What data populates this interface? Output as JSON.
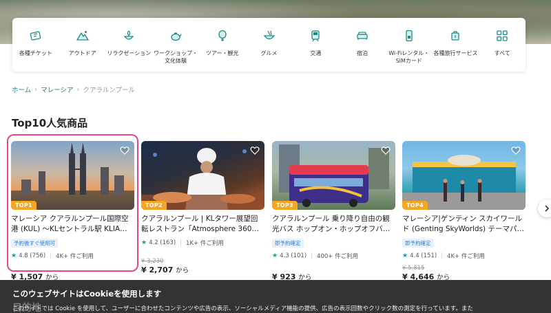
{
  "categories": [
    {
      "label": "各種チケット",
      "icon": "ticket-icon"
    },
    {
      "label": "アウトドア",
      "icon": "mountain-icon"
    },
    {
      "label": "リラクゼーション",
      "icon": "spa-icon"
    },
    {
      "label": "ワークショップ・文化体験",
      "icon": "teapot-icon"
    },
    {
      "label": "ツアー・観光",
      "icon": "balloon-icon"
    },
    {
      "label": "グルメ",
      "icon": "food-bowl-icon"
    },
    {
      "label": "交通",
      "icon": "train-icon"
    },
    {
      "label": "宿泊",
      "icon": "bed-icon"
    },
    {
      "label": "Wi-Fiレンタル・SIMカード",
      "icon": "phone-sim-icon"
    },
    {
      "label": "各種旅行サービス",
      "icon": "luggage-icon"
    },
    {
      "label": "すべて",
      "icon": "grid-icon"
    }
  ],
  "breadcrumb": {
    "home": "ホーム",
    "country": "マレーシア",
    "current": "クアラルンプール",
    "separator": "›"
  },
  "heading": "Top10人気商品",
  "products": [
    {
      "rank": "TOP1",
      "title": "マレーシア クアラルンプール国際空港 (KUL) 〜KLセントラル駅 KLIA…",
      "tag": "予約後すぐ使用可",
      "rating": "4.8 (756)",
      "booked": "4K+ 件ご利用",
      "old_price": "",
      "price": "¥ 1,507",
      "from": "から"
    },
    {
      "rank": "TOP2",
      "title": "クアラルンプール | KLタワー展望回転レストラン「Atmosphere 360…",
      "tag": "",
      "rating": "4.2 (163)",
      "booked": "1K+ 件ご利用",
      "old_price": "¥ 3,230",
      "price": "¥ 2,707",
      "from": "から"
    },
    {
      "rank": "TOP3",
      "title": "クアラルンプール 乗り降り自由の観光バス ホップオン・ホップオフバ…",
      "tag": "即予約確定",
      "rating": "4.3 (101)",
      "booked": "400+ 件ご利用",
      "old_price": "",
      "price": "¥ 923",
      "from": "から"
    },
    {
      "rank": "TOP4",
      "title": "マレーシア|ゲンティン スカイワールド (Genting SkyWorlds) テーマパ…",
      "tag": "即予約確定",
      "rating": "4.4 (151)",
      "booked": "4K+ 件ご利用",
      "old_price": "¥ 5,815",
      "price": "¥ 4,646",
      "from": "から"
    }
  ],
  "cookie": {
    "title": "このウェブサイトはCookieを使用します",
    "body": "このサイトでは Cookie を使用して、ユーザーに合わせたコンテンツや広告の表示、ソーシャルメディア機能の提供、広告の表示回数やクリック数の測定を行っています。また",
    "behind_heading": "目的地"
  },
  "colors": {
    "accent": "#1a8a86",
    "badge": "#f5a623",
    "highlight": "#e8458a"
  }
}
